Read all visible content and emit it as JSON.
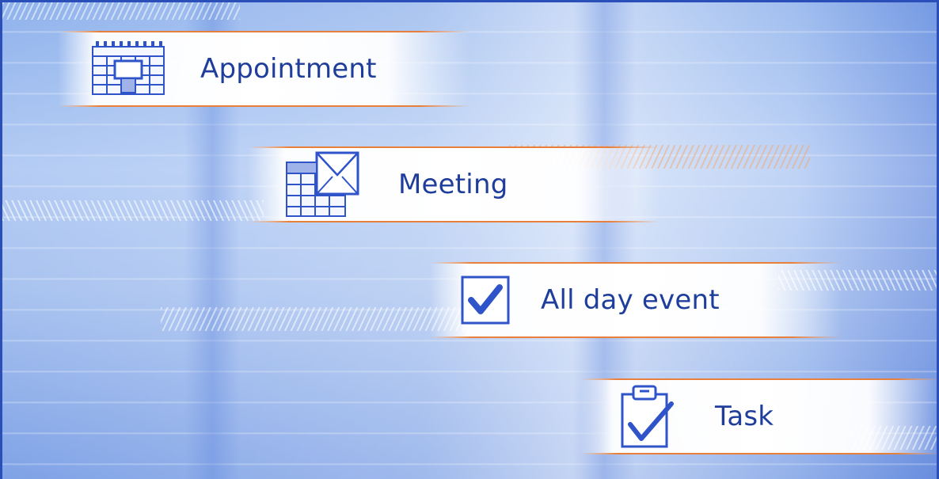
{
  "items": [
    {
      "label": "Appointment",
      "icon": "calendar-icon"
    },
    {
      "label": "Meeting",
      "icon": "calendar-envelope-icon"
    },
    {
      "label": "All day event",
      "icon": "checkbox-icon"
    },
    {
      "label": "Task",
      "icon": "clipboard-check-icon"
    }
  ],
  "colors": {
    "text": "#1f3e9c",
    "icon_stroke": "#2f54c9",
    "accent_line": "#e8803c",
    "frame": "#2b4fb8"
  }
}
